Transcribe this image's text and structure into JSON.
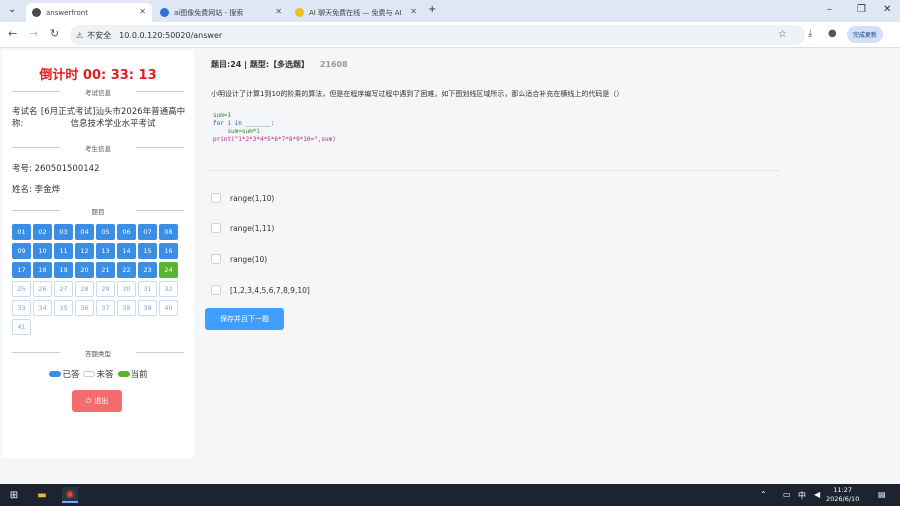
{
  "browser": {
    "tabs": [
      {
        "label": "answerfront",
        "active": true,
        "color": "#4a4a4a"
      },
      {
        "label": "ai图像免费网站 - 搜索",
        "active": false,
        "color": "#2f6fd6"
      },
      {
        "label": "AI 聊天免费在线 — 免费与 AI",
        "active": false,
        "color": "#f0c020"
      }
    ],
    "new_tab": "+",
    "security_label": "不安全",
    "url": "10.0.0.120:50020/answer",
    "profile_label": "完成更新"
  },
  "sidebar": {
    "timer": "倒计时 00: 33: 13",
    "exam_section": "考试信息",
    "exam_label": "考试名称:",
    "exam_name": "[6月正式考试]汕头市2026年普通高中信息技术学业水平考试",
    "student_section": "考生信息",
    "student_id_label": "考号:",
    "student_id": "260501500142",
    "student_name_label": "姓名:",
    "student_name": "李金烨",
    "questions_section": "题目",
    "questions": [
      {
        "n": "01",
        "s": "answered"
      },
      {
        "n": "02",
        "s": "answered"
      },
      {
        "n": "03",
        "s": "answered"
      },
      {
        "n": "04",
        "s": "answered"
      },
      {
        "n": "05",
        "s": "answered"
      },
      {
        "n": "06",
        "s": "answered"
      },
      {
        "n": "07",
        "s": "answered"
      },
      {
        "n": "08",
        "s": "answered"
      },
      {
        "n": "09",
        "s": "answered"
      },
      {
        "n": "10",
        "s": "answered"
      },
      {
        "n": "11",
        "s": "answered"
      },
      {
        "n": "12",
        "s": "answered"
      },
      {
        "n": "13",
        "s": "answered"
      },
      {
        "n": "14",
        "s": "answered"
      },
      {
        "n": "15",
        "s": "answered"
      },
      {
        "n": "16",
        "s": "answered"
      },
      {
        "n": "17",
        "s": "answered"
      },
      {
        "n": "18",
        "s": "answered"
      },
      {
        "n": "19",
        "s": "answered"
      },
      {
        "n": "20",
        "s": "answered"
      },
      {
        "n": "21",
        "s": "answered"
      },
      {
        "n": "22",
        "s": "answered"
      },
      {
        "n": "23",
        "s": "answered"
      },
      {
        "n": "24",
        "s": "current"
      },
      {
        "n": "25",
        "s": "empty"
      },
      {
        "n": "26",
        "s": "empty"
      },
      {
        "n": "27",
        "s": "empty"
      },
      {
        "n": "28",
        "s": "empty"
      },
      {
        "n": "29",
        "s": "empty"
      },
      {
        "n": "30",
        "s": "empty"
      },
      {
        "n": "31",
        "s": "empty"
      },
      {
        "n": "32",
        "s": "empty"
      },
      {
        "n": "33",
        "s": "empty"
      },
      {
        "n": "34",
        "s": "empty"
      },
      {
        "n": "35",
        "s": "empty"
      },
      {
        "n": "36",
        "s": "empty"
      },
      {
        "n": "37",
        "s": "empty"
      },
      {
        "n": "38",
        "s": "empty"
      },
      {
        "n": "39",
        "s": "empty"
      },
      {
        "n": "40",
        "s": "empty"
      },
      {
        "n": "41",
        "s": "empty"
      }
    ],
    "legend_section": "答题类型",
    "legend_answered": "已答",
    "legend_unanswered": "未答",
    "legend_current": "当前",
    "exit_label": "退出",
    "colors": {
      "answered": "#3a8ee6",
      "current": "#5ab52e",
      "unanswered": "#ffffff",
      "timer": "#e02020",
      "exit": "#f56c6c"
    }
  },
  "question": {
    "header": "题目:24 | 题型:【多选题】",
    "id": "21608",
    "text": "小明设计了计算1到10的阶乘的算法，但是在程序编写过程中遇到了困难，如下图划线区域所示，那么适合补充在横线上的代码是（）",
    "code_lines": [
      "sum=1",
      "for i in _______:",
      "    sum=sum*i",
      "print(\"1*2*3*4*5*6*7*8*9*10=\",sum)"
    ],
    "options": [
      "range(1,10)",
      "range(1,11)",
      "range(10)",
      "[1,2,3,4,5,6,7,8,9,10]"
    ],
    "submit_label": "保存并且下一题"
  },
  "taskbar": {
    "clock_time": "11:27",
    "clock_date": "2026/6/10",
    "ime": "中"
  }
}
